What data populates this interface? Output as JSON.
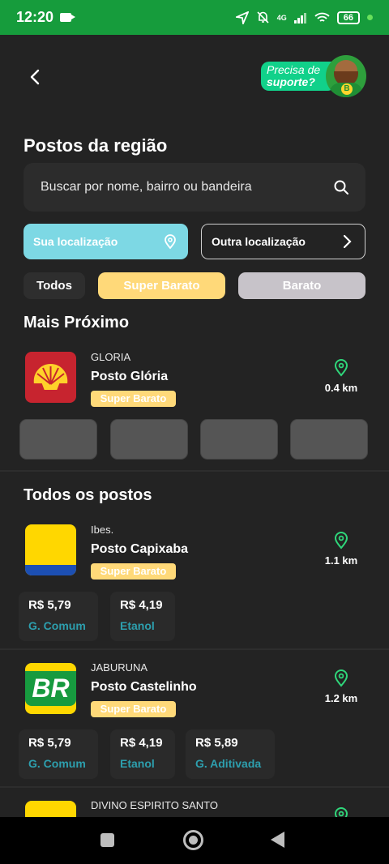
{
  "status_bar": {
    "time": "12:20",
    "network": "4G",
    "battery": "66"
  },
  "header": {
    "support_line1": "Precisa de",
    "support_line2": "suporte?"
  },
  "page_title": "Postos da região",
  "search": {
    "placeholder": "Buscar por nome, bairro ou bandeira"
  },
  "location": {
    "mine_label": "Sua localização",
    "other_label": "Outra localização"
  },
  "filters": {
    "all": "Todos",
    "super_barato": "Super Barato",
    "barato": "Barato"
  },
  "nearest": {
    "heading": "Mais Próximo",
    "station": {
      "region": "GLORIA",
      "name": "Posto Glória",
      "tag": "Super Barato",
      "distance": "0.4 km",
      "brand": "shell"
    }
  },
  "all_stations": {
    "heading": "Todos os postos",
    "items": [
      {
        "region": "Ibes.",
        "name": "Posto Capixaba",
        "tag": "Super Barato",
        "distance": "1.1 km",
        "brand": "ipiranga-style",
        "prices": [
          {
            "value": "R$ 5,79",
            "label": "G. Comum"
          },
          {
            "value": "R$ 4,19",
            "label": "Etanol"
          }
        ]
      },
      {
        "region": "JABURUNA",
        "name": "Posto Castelinho",
        "tag": "Super Barato",
        "distance": "1.2 km",
        "brand": "petrobras-br",
        "brand_text": "BR",
        "prices": [
          {
            "value": "R$ 5,79",
            "label": "G. Comum"
          },
          {
            "value": "R$ 4,19",
            "label": "Etanol"
          },
          {
            "value": "R$ 5,89",
            "label": "G. Aditivada"
          }
        ]
      },
      {
        "region": "DIVINO ESPIRITO SANTO",
        "brand": "ipiranga-style"
      }
    ]
  },
  "colors": {
    "status_green": "#169c3c",
    "accent_cyan": "#7dd8e4",
    "super_barato": "#ffd979",
    "barato": "#c7c3c9",
    "price_label": "#2d9fae",
    "pin_green": "#2fd67a"
  }
}
